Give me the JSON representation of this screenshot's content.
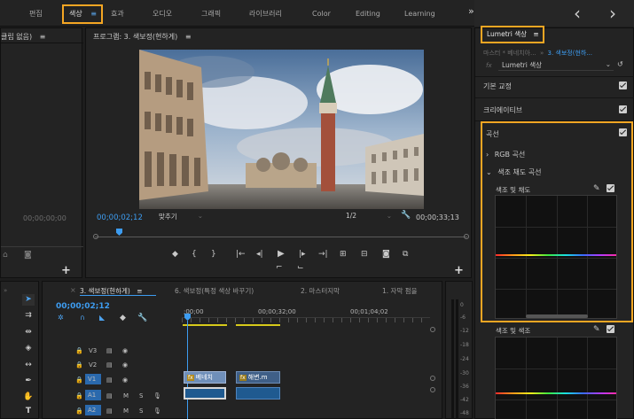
{
  "workspace_tabs": {
    "t0": "편집",
    "t1": "색상",
    "t1_menu": "≡",
    "t2": "효과",
    "t3": "오디오",
    "t4": "그래픽",
    "t5": "라이브러리",
    "t6": "Color",
    "t7": "Editing",
    "t8": "Learning",
    "more": "»"
  },
  "nav": {
    "back": "‹",
    "forward": "›"
  },
  "left_panel": {
    "title": "클립 없음)",
    "menu": "≡",
    "timecode": "00;00;00;00"
  },
  "program": {
    "title": "프로그램: 3. 색보정(현하게)",
    "menu": "≡",
    "timecode": "00;00;02;12",
    "fit": "맞추기",
    "quality": "1/2",
    "duration": "00;00;33;13"
  },
  "lumetri": {
    "title": "Lumetri 색상",
    "menu": "≡",
    "source": "마스터 * 베네치아...",
    "source_sep": "»",
    "clip": "3. 색보정(현하...",
    "fx": "fx",
    "effect": "Lumetri 색상",
    "basic": "기본 교정",
    "creative": "크리에이티브",
    "curves": "곡선",
    "rgb_curves": "RGB 곡선",
    "hue_sat_curves": "색조 채도 곡선",
    "hue_vs_sat": "색조 및 채도",
    "hue_vs_hue": "색조 및 색조"
  },
  "timeline": {
    "close": "×",
    "tab_active": "3. 색보정(현하게)",
    "tab_active_menu": "≡",
    "tab2": "6. 색보정(특정 색상 바꾸기)",
    "tab3": "2. 마스터지막",
    "tab4": "1. 자막 펌을",
    "timecode": "00;00;02;12",
    "ruler": [
      ";00;00",
      "00;00;32;00",
      "00;01;04;02"
    ],
    "tracks": [
      {
        "name": "V3",
        "m": "",
        "s": ""
      },
      {
        "name": "V2",
        "m": "",
        "s": ""
      },
      {
        "name": "V1",
        "m": "",
        "s": ""
      },
      {
        "name": "A1",
        "m": "M",
        "s": "S"
      },
      {
        "name": "A2",
        "m": "M",
        "s": "S"
      }
    ],
    "clip1": "베네치",
    "clip2": "해변.m",
    "fx_badge": "fx"
  },
  "meter": {
    "ticks": [
      "0",
      "-6",
      "-12",
      "-18",
      "-24",
      "-30",
      "-36",
      "-42",
      "-48"
    ]
  }
}
